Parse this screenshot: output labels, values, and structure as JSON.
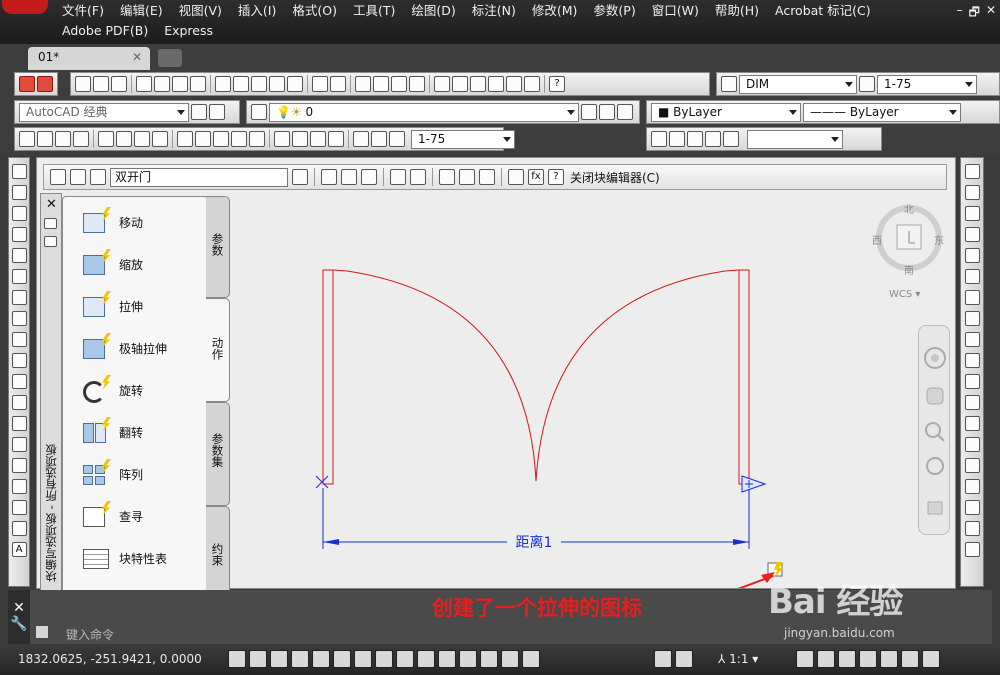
{
  "menu": {
    "row1": [
      "文件(F)",
      "编辑(E)",
      "视图(V)",
      "插入(I)",
      "格式(O)",
      "工具(T)",
      "绘图(D)",
      "标注(N)",
      "修改(M)",
      "参数(P)",
      "窗口(W)",
      "帮助(H)",
      "Acrobat 标记(C)"
    ],
    "row2": [
      "Adobe PDF(B)",
      "Express"
    ]
  },
  "window_controls": [
    "–",
    "🗗",
    "✕"
  ],
  "tabs": {
    "doc_tab_label": "01*",
    "close_glyph": "✕"
  },
  "toolbar": {
    "dim_style": "DIM",
    "dim_scale": "1-75",
    "workspace": "AutoCAD 经典",
    "layer": "0",
    "color": "ByLayer",
    "linetype": "ByLayer",
    "annotation_scale": "1-75"
  },
  "block_editor": {
    "block_name": "双开门",
    "close_label": "关闭块编辑器(C)"
  },
  "palette": {
    "title": "块编写选项板 - 所有选项板",
    "close_glyph": "✕",
    "items": [
      "移动",
      "缩放",
      "拉伸",
      "极轴拉伸",
      "旋转",
      "翻转",
      "阵列",
      "查寻",
      "块特性表"
    ],
    "tabs": [
      "参数",
      "动作",
      "参数集",
      "约束"
    ]
  },
  "compass": {
    "north": "北",
    "west": "西",
    "east": "东",
    "south": "南",
    "wcs": "WCS"
  },
  "drawing": {
    "dimension_label": "距离1",
    "line_color": "#d01818",
    "dim_color": "#1a2fd0"
  },
  "annotation": {
    "text": "创建了一个拉伸的图标",
    "color": "#e5201e"
  },
  "command": {
    "placeholder": "键入命令"
  },
  "status": {
    "coords": "1832.0625,  -251.9421,  0.0000",
    "scale": "1:1"
  },
  "watermark": {
    "main": "Bai 经验",
    "sub": "jingyan.baidu.com"
  }
}
